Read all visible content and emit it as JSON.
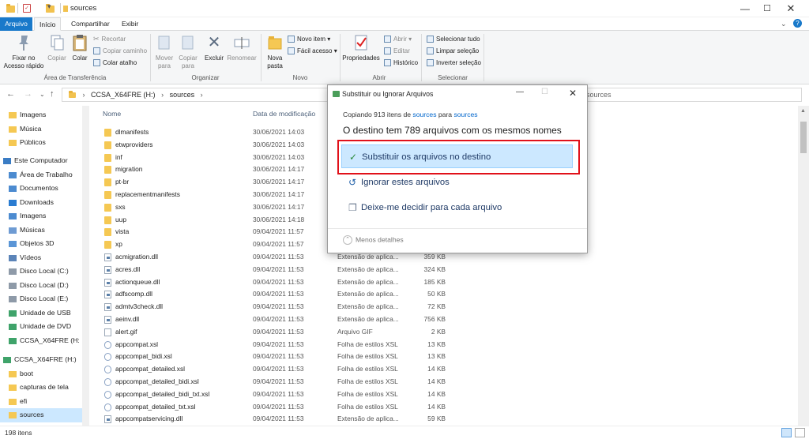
{
  "window": {
    "title": "sources"
  },
  "tabs": [
    "Arquivo",
    "Início",
    "Compartilhar",
    "Exibir"
  ],
  "ribbon": {
    "pin_label": "Fixar no Acesso rápido",
    "copy_label": "Copiar",
    "paste_label": "Colar",
    "cut_label": "Recortar",
    "copy_path_label": "Copiar caminho",
    "paste_shortcut_label": "Colar atalho",
    "move_to_label": "Mover para",
    "copy_to_label": "Copiar para",
    "delete_label": "Excluir",
    "rename_label": "Renomear",
    "new_folder_label": "Nova pasta",
    "new_item_label": "Novo item",
    "easy_access_label": "Fácil acesso",
    "properties_label": "Propriedades",
    "open_label": "Abrir",
    "edit_label": "Editar",
    "history_label": "Histórico",
    "select_all_label": "Selecionar tudo",
    "select_none_label": "Limpar seleção",
    "invert_selection_label": "Inverter seleção",
    "groups": [
      "Área de Transferência",
      "Organizar",
      "Novo",
      "Abrir",
      "Selecionar"
    ]
  },
  "address": {
    "drive": "CCSA_X64FRE (H:)",
    "folder": "sources",
    "search_placeholder": "sources"
  },
  "sidebar": {
    "items": [
      "Imagens",
      "Música",
      "Públicos",
      "Este Computador",
      "Área de Trabalho",
      "Documentos",
      "Downloads",
      "Imagens",
      "Músicas",
      "Objetos 3D",
      "Vídeos",
      "Disco Local (C:)",
      "Disco Local (D:)",
      "Disco Local (E:)",
      "Unidade de USB",
      "Unidade de DVD",
      "CCSA_X64FRE (H:",
      "CCSA_X64FRE (H:)",
      "boot",
      "capturas de tela",
      "efi",
      "sources"
    ]
  },
  "columns": {
    "name": "Nome",
    "date": "Data de modificação"
  },
  "files": [
    {
      "name": "dlmanifests",
      "date": "30/06/2021 14:03",
      "type": "",
      "size": ""
    },
    {
      "name": "etwproviders",
      "date": "30/06/2021 14:03",
      "type": "",
      "size": ""
    },
    {
      "name": "inf",
      "date": "30/06/2021 14:03",
      "type": "",
      "size": ""
    },
    {
      "name": "migration",
      "date": "30/06/2021 14:17",
      "type": "",
      "size": ""
    },
    {
      "name": "pt-br",
      "date": "30/06/2021 14:17",
      "type": "",
      "size": ""
    },
    {
      "name": "replacementmanifests",
      "date": "30/06/2021 14:17",
      "type": "",
      "size": ""
    },
    {
      "name": "sxs",
      "date": "30/06/2021 14:17",
      "type": "",
      "size": ""
    },
    {
      "name": "uup",
      "date": "30/06/2021 14:18",
      "type": "",
      "size": ""
    },
    {
      "name": "vista",
      "date": "09/04/2021 11:57",
      "type": "",
      "size": ""
    },
    {
      "name": "xp",
      "date": "09/04/2021 11:57",
      "type": "",
      "size": ""
    },
    {
      "name": "acmigration.dll",
      "date": "09/04/2021 11:53",
      "type": "Extensão de aplica...",
      "size": "359 KB"
    },
    {
      "name": "acres.dll",
      "date": "09/04/2021 11:53",
      "type": "Extensão de aplica...",
      "size": "324 KB"
    },
    {
      "name": "actionqueue.dll",
      "date": "09/04/2021 11:53",
      "type": "Extensão de aplica...",
      "size": "185 KB"
    },
    {
      "name": "adfscomp.dll",
      "date": "09/04/2021 11:53",
      "type": "Extensão de aplica...",
      "size": "50 KB"
    },
    {
      "name": "admtv3check.dll",
      "date": "09/04/2021 11:53",
      "type": "Extensão de aplica...",
      "size": "72 KB"
    },
    {
      "name": "aeinv.dll",
      "date": "09/04/2021 11:53",
      "type": "Extensão de aplica...",
      "size": "756 KB"
    },
    {
      "name": "alert.gif",
      "date": "09/04/2021 11:53",
      "type": "Arquivo GIF",
      "size": "2 KB"
    },
    {
      "name": "appcompat.xsl",
      "date": "09/04/2021 11:53",
      "type": "Folha de estilos XSL",
      "size": "13 KB"
    },
    {
      "name": "appcompat_bidi.xsl",
      "date": "09/04/2021 11:53",
      "type": "Folha de estilos XSL",
      "size": "13 KB"
    },
    {
      "name": "appcompat_detailed.xsl",
      "date": "09/04/2021 11:53",
      "type": "Folha de estilos XSL",
      "size": "14 KB"
    },
    {
      "name": "appcompat_detailed_bidi.xsl",
      "date": "09/04/2021 11:53",
      "type": "Folha de estilos XSL",
      "size": "14 KB"
    },
    {
      "name": "appcompat_detailed_bidi_txt.xsl",
      "date": "09/04/2021 11:53",
      "type": "Folha de estilos XSL",
      "size": "14 KB"
    },
    {
      "name": "appcompat_detailed_txt.xsl",
      "date": "09/04/2021 11:53",
      "type": "Folha de estilos XSL",
      "size": "14 KB"
    },
    {
      "name": "appcompatservicing.dll",
      "date": "09/04/2021 11:53",
      "type": "Extensão de aplica...",
      "size": "59 KB"
    }
  ],
  "status": {
    "item_count": "198 itens"
  },
  "dialog": {
    "title": "Substituir ou Ignorar Arquivos",
    "copy_prefix": "Copiando 913 itens de ",
    "copy_from": "sources",
    "copy_mid": " para ",
    "copy_to": "sources",
    "heading": "O destino tem 789 arquivos com os mesmos nomes",
    "option_replace": "Substituir os arquivos no destino",
    "option_skip": "Ignorar estes arquivos",
    "option_decide": "Deixe-me decidir para cada arquivo",
    "less_details": "Menos detalhes"
  }
}
